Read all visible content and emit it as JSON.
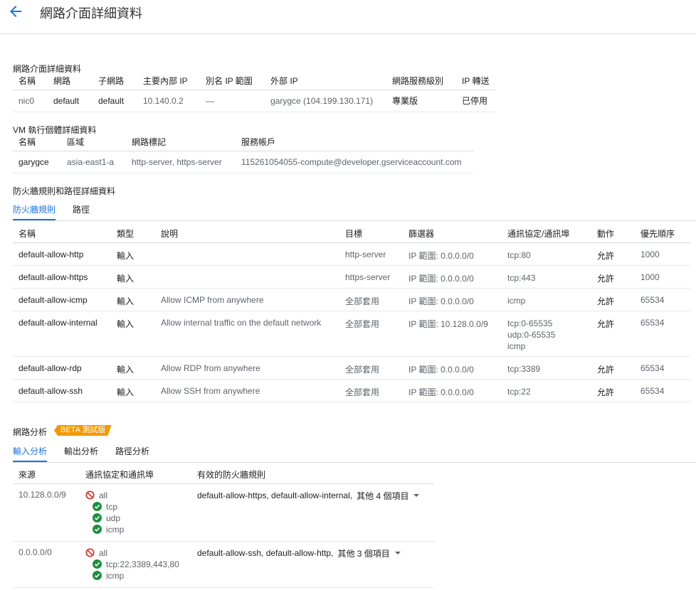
{
  "header": {
    "title": "網路介面詳細資料"
  },
  "nic_section": {
    "title": "網路介面詳細資料",
    "columns": [
      "名稱",
      "網路",
      "子網路",
      "主要內部 IP",
      "別名 IP 範圍",
      "外部 IP",
      "網路服務級別",
      "IP 轉送"
    ],
    "row": [
      "nic0",
      "default",
      "default",
      "10.140.0.2",
      "—",
      "garygce (104.199.130.171)",
      "專業版",
      "已停用"
    ]
  },
  "vm_section": {
    "title": "VM 執行個體詳細資料",
    "columns": [
      "名稱",
      "區域",
      "網路標記",
      "服務帳戶"
    ],
    "row": [
      "garygce",
      "asia-east1-a",
      "http-server, https-server",
      "115261054055-compute@developer.gserviceaccount.com"
    ]
  },
  "fw_section": {
    "title": "防火牆規則和路徑詳細資料",
    "tabs": [
      "防火牆規則",
      "路徑"
    ],
    "columns": [
      "名稱",
      "類型",
      "說明",
      "目標",
      "篩選器",
      "通訊協定/通訊埠",
      "動作",
      "優先順序"
    ],
    "rows": [
      {
        "name": "default-allow-http",
        "type": "輸入",
        "desc": "",
        "target": "http-server",
        "filter": "IP 範圍: 0.0.0.0/0",
        "ports": [
          "tcp:80"
        ],
        "action": "允許",
        "priority": "1000"
      },
      {
        "name": "default-allow-https",
        "type": "輸入",
        "desc": "",
        "target": "https-server",
        "filter": "IP 範圍: 0.0.0.0/0",
        "ports": [
          "tcp:443"
        ],
        "action": "允許",
        "priority": "1000"
      },
      {
        "name": "default-allow-icmp",
        "type": "輸入",
        "desc": "Allow ICMP from anywhere",
        "target": "全部套用",
        "filter": "IP 範圍: 0.0.0.0/0",
        "ports": [
          "icmp"
        ],
        "action": "允許",
        "priority": "65534"
      },
      {
        "name": "default-allow-internal",
        "type": "輸入",
        "desc": "Allow internal traffic on the default network",
        "target": "全部套用",
        "filter": "IP 範圍: 10.128.0.0/9",
        "ports": [
          "tcp:0-65535",
          "udp:0-65535",
          "icmp"
        ],
        "action": "允許",
        "priority": "65534"
      },
      {
        "name": "default-allow-rdp",
        "type": "輸入",
        "desc": "Allow RDP from anywhere",
        "target": "全部套用",
        "filter": "IP 範圍: 0.0.0.0/0",
        "ports": [
          "tcp:3389"
        ],
        "action": "允許",
        "priority": "65534"
      },
      {
        "name": "default-allow-ssh",
        "type": "輸入",
        "desc": "Allow SSH from anywhere",
        "target": "全部套用",
        "filter": "IP 範圍: 0.0.0.0/0",
        "ports": [
          "tcp:22"
        ],
        "action": "允許",
        "priority": "65534"
      }
    ]
  },
  "analysis_section": {
    "title": "網路分析",
    "badge": "BETA 測試版",
    "tabs": [
      "輸入分析",
      "輸出分析",
      "路徑分析"
    ],
    "columns": [
      "來源",
      "通訊協定和通訊埠",
      "有效的防火牆規則"
    ],
    "rows": [
      {
        "source": "10.128.0.0/9",
        "denied": "all",
        "allowed": [
          "tcp",
          "udp",
          "icmp"
        ],
        "rules": "default-allow-https, default-allow-internal,",
        "more": "其他 4 個項目"
      },
      {
        "source": "0.0.0.0/0",
        "denied": "all",
        "allowed": [
          "tcp:22,3389,443,80",
          "icmp"
        ],
        "rules": "default-allow-ssh, default-allow-http,",
        "more": "其他 3 個項目"
      }
    ]
  },
  "colors": {
    "accent": "#1a73e8",
    "badge": "#f29900",
    "allow": "#1e8e3e",
    "deny": "#d93025"
  },
  "icons": {
    "back": "arrow-left-icon",
    "allow": "check-circle-icon",
    "deny": "block-icon",
    "expand": "caret-down-icon"
  }
}
